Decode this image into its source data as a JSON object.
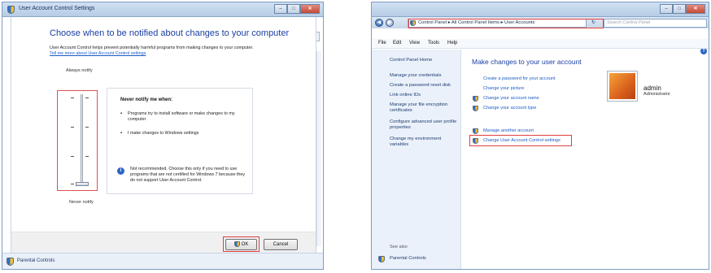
{
  "uac_window": {
    "title": "User Account Control Settings",
    "heading": "Choose when to be notified about changes to your computer",
    "description": "User Account Control helps prevent potentially harmful programs from making changes to your computer.",
    "link": "Tell me more about User Account Control settings",
    "slider_top_label": "Always notify",
    "slider_bottom_label": "Never notify",
    "slider_level": 0,
    "info_title": "Never notify me when:",
    "bullets": [
      "Programs try to install software or make changes to my computer",
      "I make changes to Windows settings"
    ],
    "warning": "Not recommended. Choose this only if you need to use programs that are not certified for Windows 7 because they do not support User Account Control.",
    "ok_label": "OK",
    "cancel_label": "Cancel",
    "status_item": "Parental Controls"
  },
  "cp_window": {
    "breadcrumbs": "Control Panel ▸ All Control Panel Items ▸ User Accounts",
    "search_placeholder": "Search Control Panel",
    "menu": [
      "File",
      "Edit",
      "View",
      "Tools",
      "Help"
    ],
    "left_pane": [
      "Control Panel Home",
      "Manage your credentials",
      "Create a password reset disk",
      "Link online IDs",
      "Manage your file encryption certificates",
      "Configure advanced user profile properties",
      "Change my environment variables"
    ],
    "main_title": "Make changes to your user account",
    "tasks": [
      "Create a password for your account",
      "Change your picture",
      "Change your account name",
      "Change your account type"
    ],
    "tasks2": [
      "Manage another account",
      "Change User Account Control settings"
    ],
    "user_name": "admin",
    "user_role": "Administrator",
    "see_also": "See also",
    "see_also_item": "Parental Controls"
  }
}
